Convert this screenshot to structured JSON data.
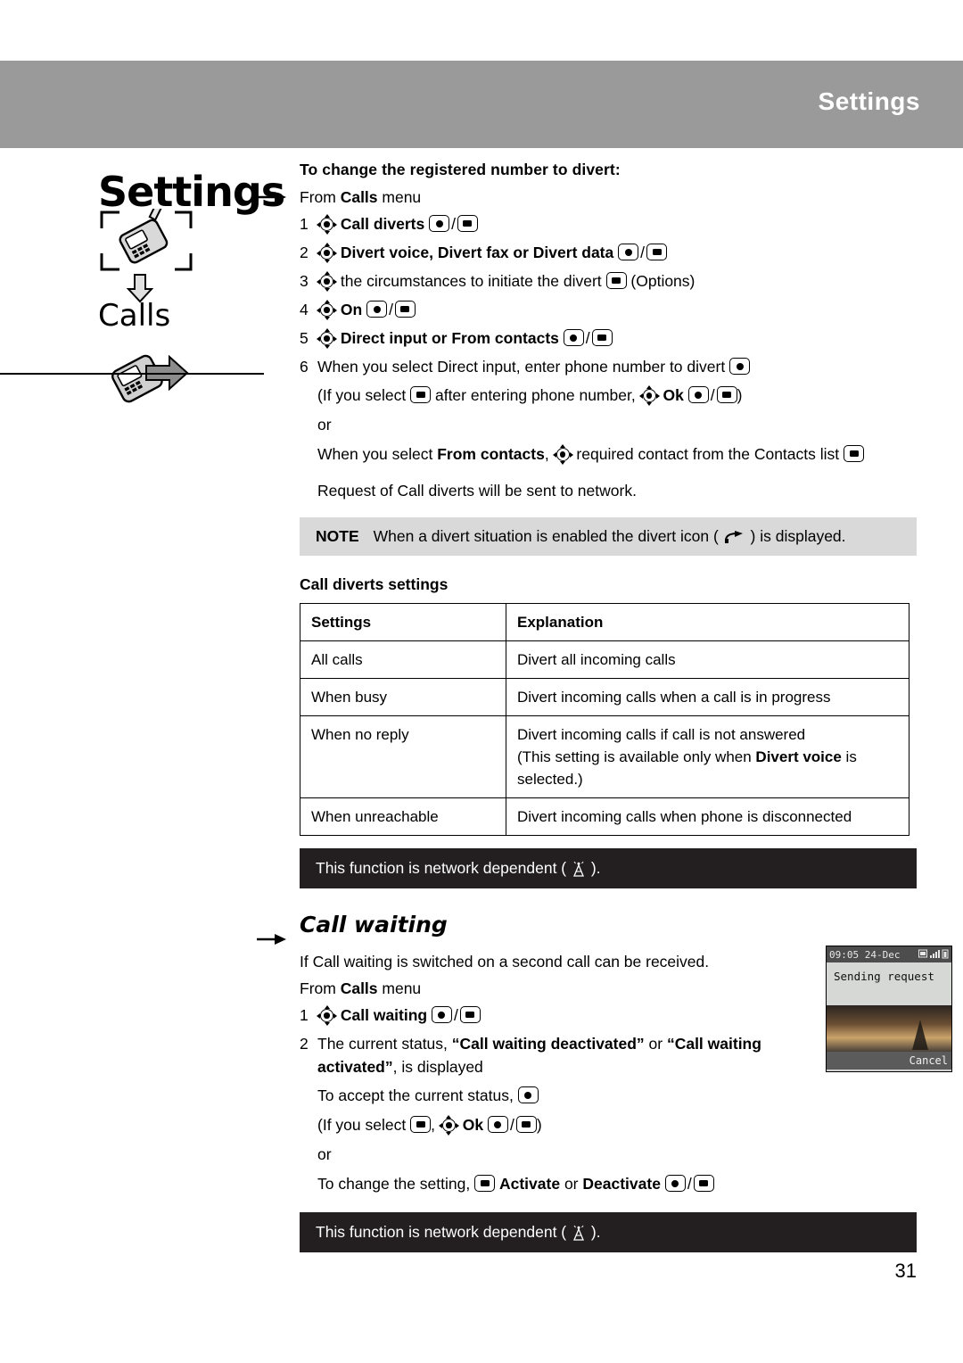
{
  "header": {
    "band_title": "Settings"
  },
  "rail": {
    "title": "Settings",
    "subtitle": "Calls",
    "phone_icon_1": "phone-outline-icon",
    "phone_icon_2": "phone-arrow-icon",
    "arrow_down_icon": "arrow-down-icon"
  },
  "main": {
    "lead": "To change the registered number to divert:",
    "from_line_prefix": "From ",
    "from_line_bold": "Calls",
    "from_line_suffix": " menu",
    "steps": [
      {
        "num": "1",
        "text": "Call diverts"
      },
      {
        "num": "2",
        "text": "Divert voice, Divert fax or Divert data"
      },
      {
        "num": "3",
        "text": "the circumstances to initiate the divert"
      },
      {
        "num": "4",
        "text": "On"
      },
      {
        "num": "5",
        "text": "Direct input or From contacts"
      },
      {
        "num": "6",
        "text": "When you select Direct input, enter phone number to divert"
      }
    ],
    "step3_tail": "(Options)",
    "step6_paren": "(If you select",
    "step6_paren_mid": "after entering phone number,",
    "step6_ok": "Ok",
    "or_text": "or",
    "from_contacts_line_a": "When you select ",
    "from_contacts_bold": "From contacts",
    "from_contacts_line_b": ", ",
    "from_contacts_line_c": " required contact from the Contacts list ",
    "request_line": "Request of Call diverts will be sent to network.",
    "note_label": "NOTE",
    "note_text_a": "When a divert situation is enabled the divert icon (",
    "note_text_b": ") is displayed.",
    "table_caption": "Call diverts settings",
    "table": {
      "headers": [
        "Settings",
        "Explanation"
      ],
      "rows": [
        [
          "All calls",
          "Divert all incoming calls"
        ],
        [
          "When busy",
          "Divert incoming calls when a call is in progress"
        ],
        [
          "When no reply",
          "Divert incoming calls if call is not answered\n(This setting is available only when Divert voice is\nselected.)"
        ],
        [
          "When unreachable",
          "Divert incoming calls when phone is disconnected"
        ]
      ],
      "row3_bold": "Divert voice"
    },
    "network_band_a": "This function is network dependent (",
    "network_band_b": ").",
    "section_heading": "Call waiting",
    "call_waiting_intro": "If Call waiting is switched on a second call can be received.",
    "cw_steps": [
      {
        "num": "1",
        "text": "Call waiting"
      },
      {
        "num": "2",
        "text": "The current status, “Call waiting deactivated” or “Call waiting activated”, is displayed"
      }
    ],
    "cw_accept": "To accept the current status,",
    "cw_paren_a": "(If you select",
    "cw_ok": "Ok",
    "cw_change_a": "To change the setting,",
    "cw_change_b": "Activate",
    "cw_change_c": "or",
    "cw_change_d": "Deactivate",
    "network_band2_a": "This function is network dependent (",
    "network_band2_b": ")."
  },
  "phone_screen": {
    "status_time": "09:05 24-Dec",
    "status_icons": "battery-signal-icons",
    "message": "Sending request",
    "softkey": "Cancel"
  },
  "page_number": "31",
  "colors": {
    "header_band": "#9a9a9a",
    "note_band": "#d9d9d9",
    "dark_band": "#231f20"
  }
}
